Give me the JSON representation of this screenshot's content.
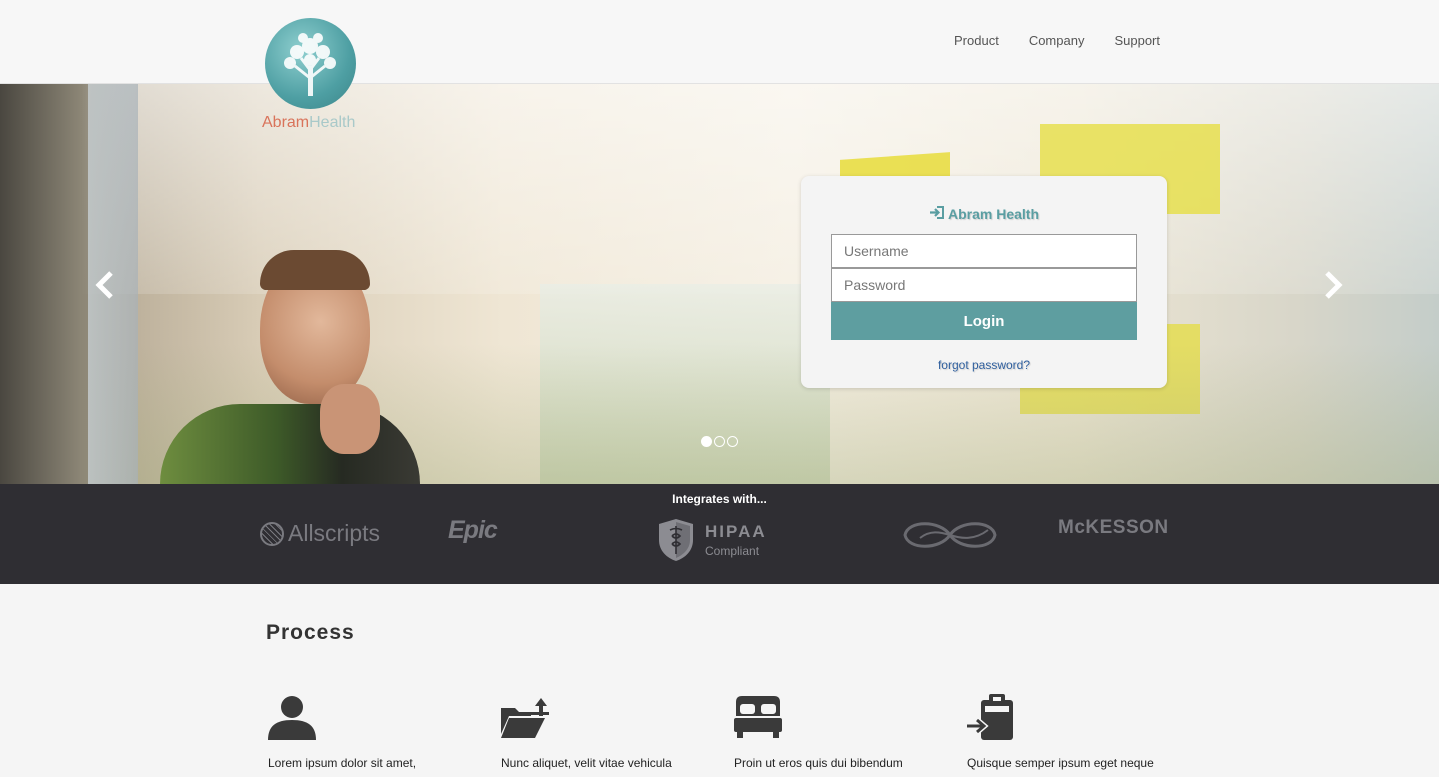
{
  "brand": {
    "logo_text_part1": "Abram",
    "logo_text_part2": "Health",
    "colors": {
      "teal": "#5e9ea0",
      "logo_accent": "#d9735a",
      "dark_band": "#2f2e33"
    }
  },
  "nav": {
    "items": [
      {
        "label": "Product"
      },
      {
        "label": "Company"
      },
      {
        "label": "Support"
      }
    ]
  },
  "carousel": {
    "prev_icon": "chevron-left-icon",
    "next_icon": "chevron-right-icon",
    "slide_count": 3,
    "active_slide": 1
  },
  "login": {
    "title": "Abram Health",
    "title_icon": "sign-in-icon",
    "username_placeholder": "Username",
    "password_placeholder": "Password",
    "button_label": "Login",
    "forgot_label": "forgot password?"
  },
  "integrations": {
    "title": "Integrates with...",
    "partners": {
      "allscripts": "Allscripts",
      "epic": "Epic",
      "hipaa_line1": "HIPAA",
      "hipaa_line2": "Compliant",
      "mckesson": "McKESSON"
    }
  },
  "process": {
    "title": "Process",
    "steps": [
      {
        "icon": "user-icon",
        "text": "Lorem ipsum dolor sit amet,"
      },
      {
        "icon": "folder-upload-icon",
        "text": "Nunc aliquet, velit vitae vehicula"
      },
      {
        "icon": "bed-icon",
        "text": "Proin ut eros quis dui bibendum"
      },
      {
        "icon": "clipboard-import-icon",
        "text": "Quisque semper ipsum eget neque"
      }
    ]
  }
}
